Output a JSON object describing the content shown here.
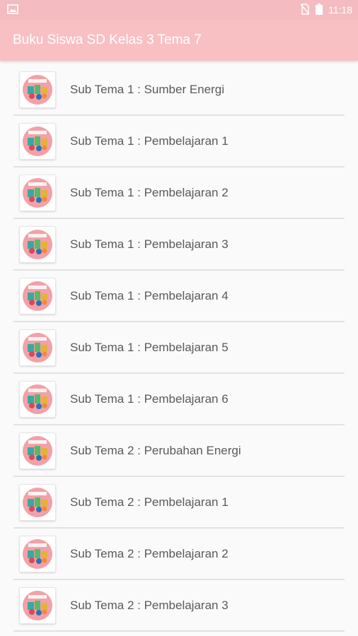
{
  "status_bar": {
    "time": "11:18"
  },
  "app_bar": {
    "title": "Buku Siswa SD Kelas 3 Tema 7"
  },
  "colors": {
    "status_bar": "#f4bcc0",
    "app_bar": "#f9c0c4",
    "book_cover": "#f2a1a8"
  },
  "items": [
    {
      "label": "Sub Tema 1 : Sumber Energi"
    },
    {
      "label": "Sub Tema 1 : Pembelajaran 1"
    },
    {
      "label": "Sub Tema 1 : Pembelajaran 2"
    },
    {
      "label": "Sub Tema 1 : Pembelajaran 3"
    },
    {
      "label": "Sub Tema 1 : Pembelajaran 4"
    },
    {
      "label": "Sub Tema 1 : Pembelajaran 5"
    },
    {
      "label": "Sub Tema 1 : Pembelajaran 6"
    },
    {
      "label": "Sub Tema 2 : Perubahan Energi"
    },
    {
      "label": "Sub Tema 2 : Pembelajaran 1"
    },
    {
      "label": "Sub Tema 2 : Pembelajaran 2"
    },
    {
      "label": "Sub Tema 2 : Pembelajaran 3"
    }
  ]
}
